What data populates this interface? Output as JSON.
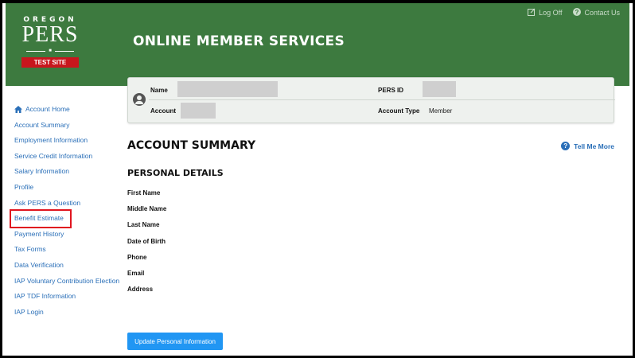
{
  "header": {
    "logo": {
      "line1": "OREGON",
      "line2": "PERS",
      "badge": "TEST SITE"
    },
    "title": "ONLINE MEMBER SERVICES",
    "log_off": "Log Off",
    "contact_us": "Contact Us"
  },
  "sidebar": {
    "items": [
      {
        "label": "Account Home"
      },
      {
        "label": "Account Summary"
      },
      {
        "label": "Employment Information"
      },
      {
        "label": "Service Credit Information"
      },
      {
        "label": "Salary Information"
      },
      {
        "label": "Profile"
      },
      {
        "label": "Ask PERS a Question"
      },
      {
        "label": "Benefit Estimate"
      },
      {
        "label": "Payment History"
      },
      {
        "label": "Tax Forms"
      },
      {
        "label": "Data Verification"
      },
      {
        "label": "IAP Voluntary Contribution Election"
      },
      {
        "label": "IAP TDF Information"
      },
      {
        "label": "IAP Login"
      }
    ],
    "highlight_color": "#e0151f"
  },
  "member_card": {
    "name_label": "Name",
    "account_label": "Account",
    "pers_id_label": "PERS ID",
    "account_type_label": "Account Type",
    "account_type_value": "Member"
  },
  "main": {
    "title": "ACCOUNT SUMMARY",
    "tell_me_more": "Tell Me More",
    "personal_details": "PERSONAL DETAILS",
    "fields": [
      "First Name",
      "Middle Name",
      "Last Name",
      "Date of Birth",
      "Phone",
      "Email",
      "Address"
    ],
    "update_button": "Update Personal Information"
  },
  "colors": {
    "header_green": "#3d7a3f",
    "link_blue": "#2a6fb8",
    "button_blue": "#2196f3",
    "test_badge_red": "#c8161d"
  }
}
